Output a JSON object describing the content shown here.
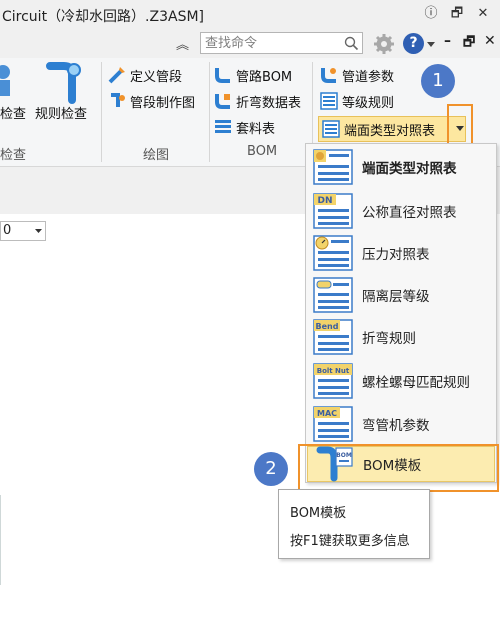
{
  "window": {
    "title": "Circuit（冷却水回路）.Z3ASM]",
    "buttons": {
      "info": "ⓘ",
      "restore": "🗗",
      "minimize": "–",
      "close": "✕"
    }
  },
  "toolbar": {
    "search_placeholder": "查找命令",
    "collapse_glyph": "︽",
    "help_glyph": "?",
    "min_glyph": "–",
    "restore_glyph": "🗗",
    "close_glyph": "✕"
  },
  "ribbon": {
    "groups": {
      "check": {
        "label": "检查",
        "buttons": {
          "check": "检查",
          "rule_check": "规则检查"
        }
      },
      "draw": {
        "label": "绘图",
        "buttons": {
          "define_segment": "定义管段",
          "segment_drawing": "管段制作图"
        }
      },
      "bom": {
        "label": "BOM",
        "buttons": {
          "pipe_bom": "管路BOM",
          "bend_table": "折弯数据表",
          "kit_table": "套料表"
        }
      },
      "params": {
        "buttons": {
          "pipe_params": "管道参数",
          "grade_rules": "等级规则",
          "end_face_table": "端面类型对照表"
        }
      }
    }
  },
  "combo": {
    "value": "0"
  },
  "dropdown_menu": {
    "items": [
      {
        "label": "端面类型对照表",
        "icon": "table-icon"
      },
      {
        "label": "公称直径对照表",
        "icon": "dn-table-icon"
      },
      {
        "label": "压力对照表",
        "icon": "pressure-gauge-icon"
      },
      {
        "label": "隔离层等级",
        "icon": "insulation-icon"
      },
      {
        "label": "折弯规则",
        "icon": "bend-rule-icon"
      },
      {
        "label": "螺栓螺母匹配规则",
        "icon": "bolt-nut-icon"
      },
      {
        "label": "弯管机参数",
        "icon": "mac-icon"
      },
      {
        "label": "BOM模板",
        "icon": "bom-template-icon"
      }
    ],
    "icon_texts": {
      "dn": "DN",
      "bend": "Bend",
      "bolt": "Bolt Nut",
      "mac": "MAC",
      "bom": "BOM"
    }
  },
  "annotations": {
    "step1": "1",
    "step2": "2"
  },
  "tooltip": {
    "title": "BOM模板",
    "hint": "按F1键获取更多信息"
  },
  "colors": {
    "accent_orange": "#f0922b",
    "badge_blue": "#4c78c7",
    "highlight": "#fde7a0"
  }
}
